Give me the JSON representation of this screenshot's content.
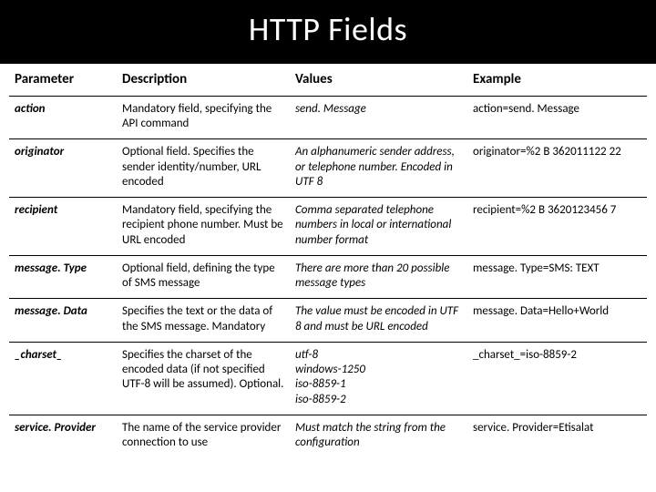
{
  "title": "HTTP Fields",
  "columns": [
    "Parameter",
    "Description",
    "Values",
    "Example"
  ],
  "rows": [
    {
      "param": "action",
      "desc": "Mandatory field, specifying the API command",
      "values": "send. Message",
      "example": "action=send. Message"
    },
    {
      "param": "originator",
      "desc": "Optional field. Specifies the sender identity/number, URL encoded",
      "values": "An alphanumeric sender address, or telephone number. Encoded in UTF 8",
      "example": "originator=%2 B 362011122 22"
    },
    {
      "param": "recipient",
      "desc": "Mandatory field, specifying the recipient phone number. Must be URL encoded",
      "values": "Comma separated telephone numbers in local or international number format",
      "example": "recipient=%2 B 3620123456 7"
    },
    {
      "param": "message. Type",
      "desc": "Optional field, defining the type of SMS message",
      "values": "There are more than 20 possible message types",
      "example": "message. Type=SMS: TEXT"
    },
    {
      "param": "message. Data",
      "desc": "Specifies the text or the data of the SMS message. Mandatory",
      "values": "The value must be encoded in UTF 8 and must be URL encoded",
      "example": "message. Data=Hello+World"
    },
    {
      "param": "_charset_",
      "desc": "Specifies the charset of the encoded data (if not specified UTF-8 will be assumed). Optional.",
      "values": "utf-8\nwindows-1250\niso-8859-1\niso-8859-2",
      "example": "_charset_=iso-8859-2"
    },
    {
      "param": "service. Provider",
      "desc": "The name of the service provider connection to use",
      "values": "Must match the string from the configuration",
      "example": "service. Provider=Etisalat"
    }
  ]
}
